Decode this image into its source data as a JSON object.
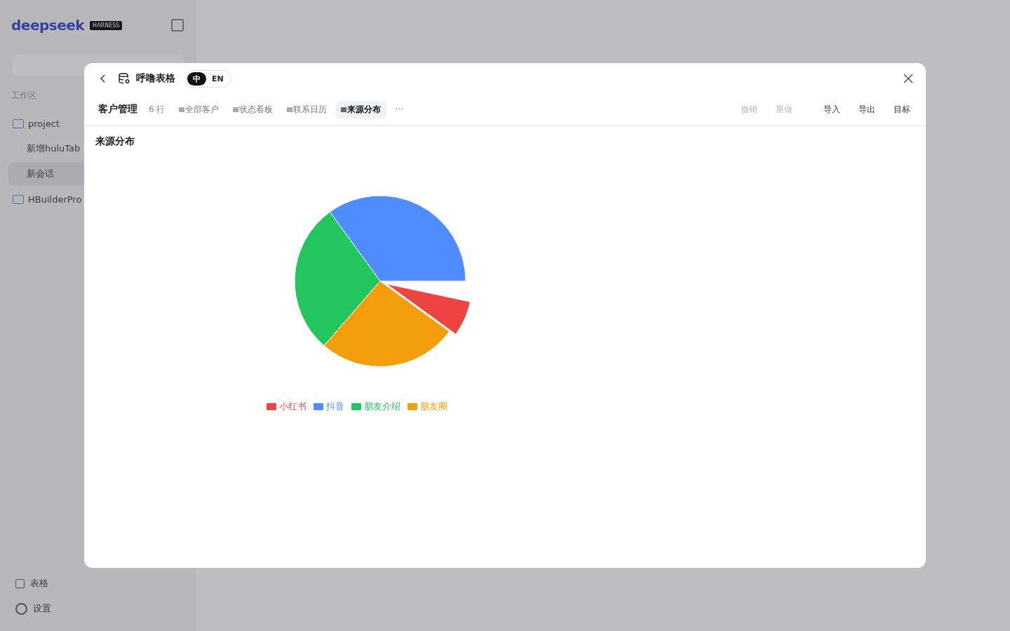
{
  "background": {
    "logo": "deepseek",
    "badge": "HARNESS",
    "section": "工作区",
    "items": [
      {
        "label": "project",
        "kind": "folder",
        "selected": false
      },
      {
        "label": "新增huluTab",
        "kind": "chat",
        "selected": false
      },
      {
        "label": "新会话",
        "kind": "chat",
        "selected": true
      },
      {
        "label": "HBuilderPro",
        "kind": "folder",
        "selected": false
      }
    ],
    "footer": [
      {
        "label": "表格",
        "kind": "table"
      },
      {
        "label": "设置",
        "kind": "gear"
      }
    ]
  },
  "dialog": {
    "title": "呼噜表格",
    "languages": [
      {
        "label": "中",
        "selected": true
      },
      {
        "label": "EN",
        "selected": false
      }
    ],
    "table_name": "客户管理",
    "row_count": "6 行",
    "views": [
      {
        "label": "全部客户",
        "selected": false
      },
      {
        "label": "状态看板",
        "selected": false
      },
      {
        "label": "联系日历",
        "selected": false
      },
      {
        "label": "来源分布",
        "selected": true
      }
    ],
    "more": "···",
    "actions": [
      {
        "label": "撤销",
        "disabled": true
      },
      {
        "label": "重做",
        "disabled": true
      },
      {
        "label": "导入",
        "disabled": false
      },
      {
        "label": "导出",
        "disabled": false
      },
      {
        "label": "目标",
        "disabled": false
      }
    ],
    "view_title": "来源分布",
    "legend": [
      {
        "label": "小红书",
        "color": "#ef4444"
      },
      {
        "label": "抖音",
        "color": "#4f8cff"
      },
      {
        "label": "朋友介绍",
        "color": "#22c55e"
      },
      {
        "label": "朋友圈",
        "color": "#f59e0b"
      }
    ]
  }
}
